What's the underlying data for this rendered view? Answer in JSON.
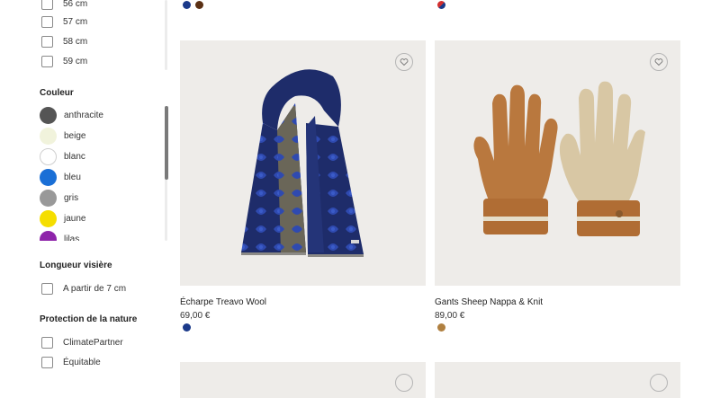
{
  "filters": {
    "taille": [
      {
        "label": "56 cm"
      },
      {
        "label": "57 cm"
      },
      {
        "label": "58 cm"
      },
      {
        "label": "59 cm"
      }
    ],
    "couleur": {
      "title": "Couleur",
      "items": [
        {
          "label": "anthracite",
          "color": "#555555"
        },
        {
          "label": "beige",
          "color": "#f1f3dc"
        },
        {
          "label": "blanc",
          "color": "#ffffff"
        },
        {
          "label": "bleu",
          "color": "#1a6fd6"
        },
        {
          "label": "gris",
          "color": "#999999"
        },
        {
          "label": "jaune",
          "color": "#f5de00"
        },
        {
          "label": "lilas",
          "color": "#8e24aa"
        }
      ]
    },
    "longueur": {
      "title": "Longueur visière",
      "items": [
        {
          "label": "A partir de 7 cm"
        }
      ]
    },
    "protection": {
      "title": "Protection de la nature",
      "items": [
        {
          "label": "ClimatePartner"
        },
        {
          "label": "Équitable"
        }
      ]
    }
  },
  "products": [
    {
      "name": "Écharpe Treavo Wool",
      "price": "69,00 €",
      "colors": [
        "#1b3a8a"
      ],
      "icon": "scarf-image"
    },
    {
      "name": "Gants Sheep Nappa & Knit",
      "price": "89,00 €",
      "colors": [
        "#b08040"
      ],
      "icon": "gloves-image"
    }
  ],
  "top_row_colors": {
    "left": [
      "#1b3a8a",
      "#5a3014"
    ],
    "right": [
      "#d32f2f"
    ]
  }
}
